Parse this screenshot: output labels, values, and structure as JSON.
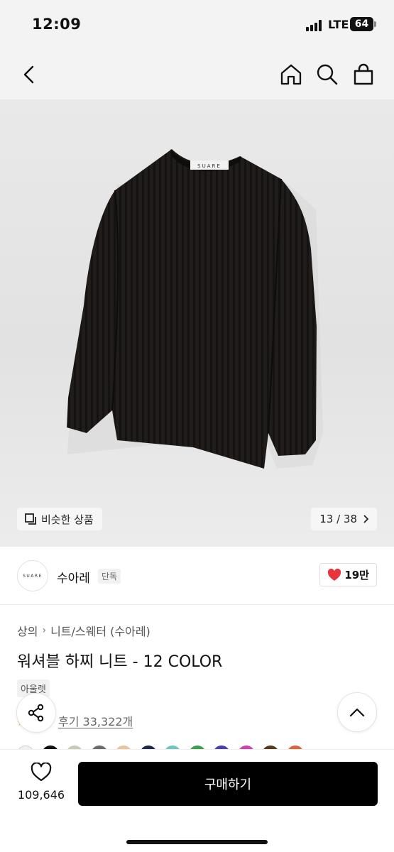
{
  "status": {
    "time": "12:09",
    "network": "LTE",
    "battery": "64"
  },
  "nav": {
    "back_icon": "chevron-left-icon",
    "home_icon": "home-icon",
    "search_icon": "search-icon",
    "cart_icon": "shopping-bag-icon"
  },
  "hero": {
    "sweater_label": "SUARE",
    "similar_label": "비슷한 상품",
    "counter": "13 / 38"
  },
  "brand": {
    "logo_text": "SUARE",
    "name": "수아레",
    "tag": "단독",
    "likes": "19만"
  },
  "breadcrumb": {
    "level1": "상의",
    "level2": "니트/스웨터 (수아레)"
  },
  "product": {
    "title": "워셔블 하찌 니트 - 12 COLOR",
    "outlet_tag": "아울렛",
    "reviews": "후기 33,322개"
  },
  "swatch_colors": [
    "#f2f2f2",
    "#111111",
    "#c9c9b4",
    "#6b6b6b",
    "#e8c49a",
    "#1d2a4a",
    "#6fc5c0",
    "#3aa14a",
    "#4a3fb0",
    "#d43fb0",
    "#5a3a1f",
    "#e0643a"
  ],
  "bottom": {
    "like_count": "109,646",
    "buy_label": "구매하기"
  },
  "colors": {
    "like_heart": "#e8323c",
    "buy_button": "#000000"
  }
}
